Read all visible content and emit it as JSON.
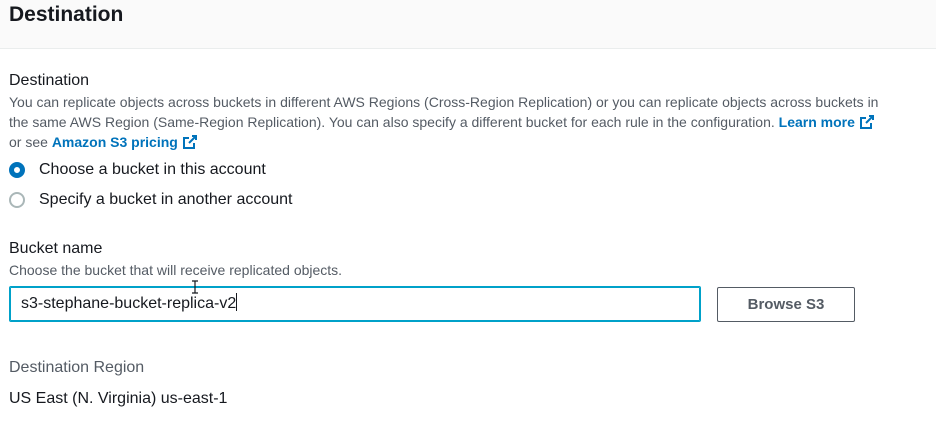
{
  "header": {
    "title": "Destination"
  },
  "destination": {
    "label": "Destination",
    "desc_line1": "You can replicate objects across buckets in different AWS Regions (Cross-Region Replication) or you can replicate objects across buckets in",
    "desc_line2_prefix": "the same AWS Region (Same-Region Replication). You can also specify a different bucket for each rule in the configuration.",
    "learn_more": "Learn more",
    "desc_line3_prefix": "or see",
    "pricing_link": "Amazon S3 pricing",
    "options": [
      {
        "label": "Choose a bucket in this account",
        "selected": true
      },
      {
        "label": "Specify a bucket in another account",
        "selected": false
      }
    ]
  },
  "bucket": {
    "label": "Bucket name",
    "hint": "Choose the bucket that will receive replicated objects.",
    "value": "s3-stephane-bucket-replica-v2",
    "browse_label": "Browse S3"
  },
  "region": {
    "label": "Destination Region",
    "value": "US East (N. Virginia) us-east-1"
  },
  "colors": {
    "link": "#0073bb",
    "focus": "#00a1c9",
    "text": "#16191f",
    "secondary_text": "#545b64"
  }
}
